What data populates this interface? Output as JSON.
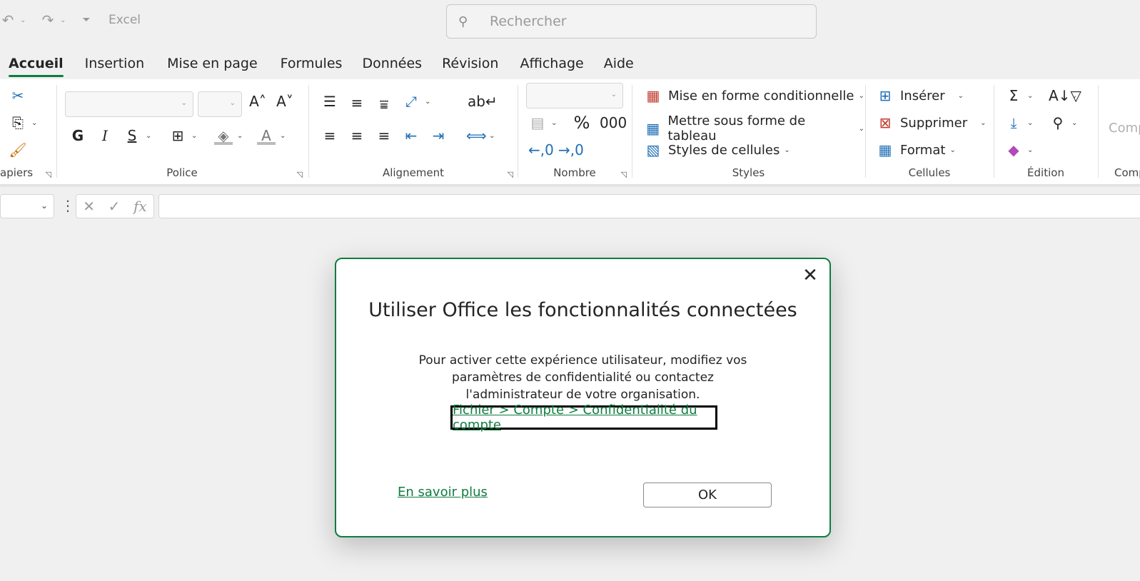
{
  "titlebar": {
    "app_name": "Excel",
    "search_placeholder": "Rechercher"
  },
  "tabs": [
    {
      "label": "Accueil",
      "active": true
    },
    {
      "label": "Insertion"
    },
    {
      "label": "Mise en page"
    },
    {
      "label": "Formules"
    },
    {
      "label": "Données"
    },
    {
      "label": "Révision"
    },
    {
      "label": "Affichage"
    },
    {
      "label": "Aide"
    }
  ],
  "ribbon": {
    "groups": {
      "clipboard": "apiers",
      "font": "Police",
      "alignment": "Alignement",
      "number": "Nombre",
      "styles": "Styles",
      "cells": "Cellules",
      "editing": "Édition",
      "comp": "Comp"
    },
    "styles": {
      "conditional": "Mise en forme conditionnelle",
      "as_table": "Mettre sous forme de tableau",
      "cell_styles": "Styles de cellules"
    },
    "cells": {
      "insert": "Insérer",
      "delete": "Supprimer",
      "format": "Format"
    },
    "font": {
      "bold": "G",
      "italic": "I",
      "underline": "S"
    },
    "number": {
      "percent": "%",
      "thousands": "000"
    },
    "comp_button": "Comp"
  },
  "dialog": {
    "title": "Utiliser Office les fonctionnalités connectées",
    "body": "Pour activer cette expérience utilisateur, modifiez vos paramètres de confidentialité ou contactez l'administrateur de votre organisation.",
    "path_link": "Fichier > Compte > Confidentialité du compte",
    "learn_more": "En savoir plus",
    "ok": "OK"
  },
  "colors": {
    "accent": "#107c41"
  }
}
